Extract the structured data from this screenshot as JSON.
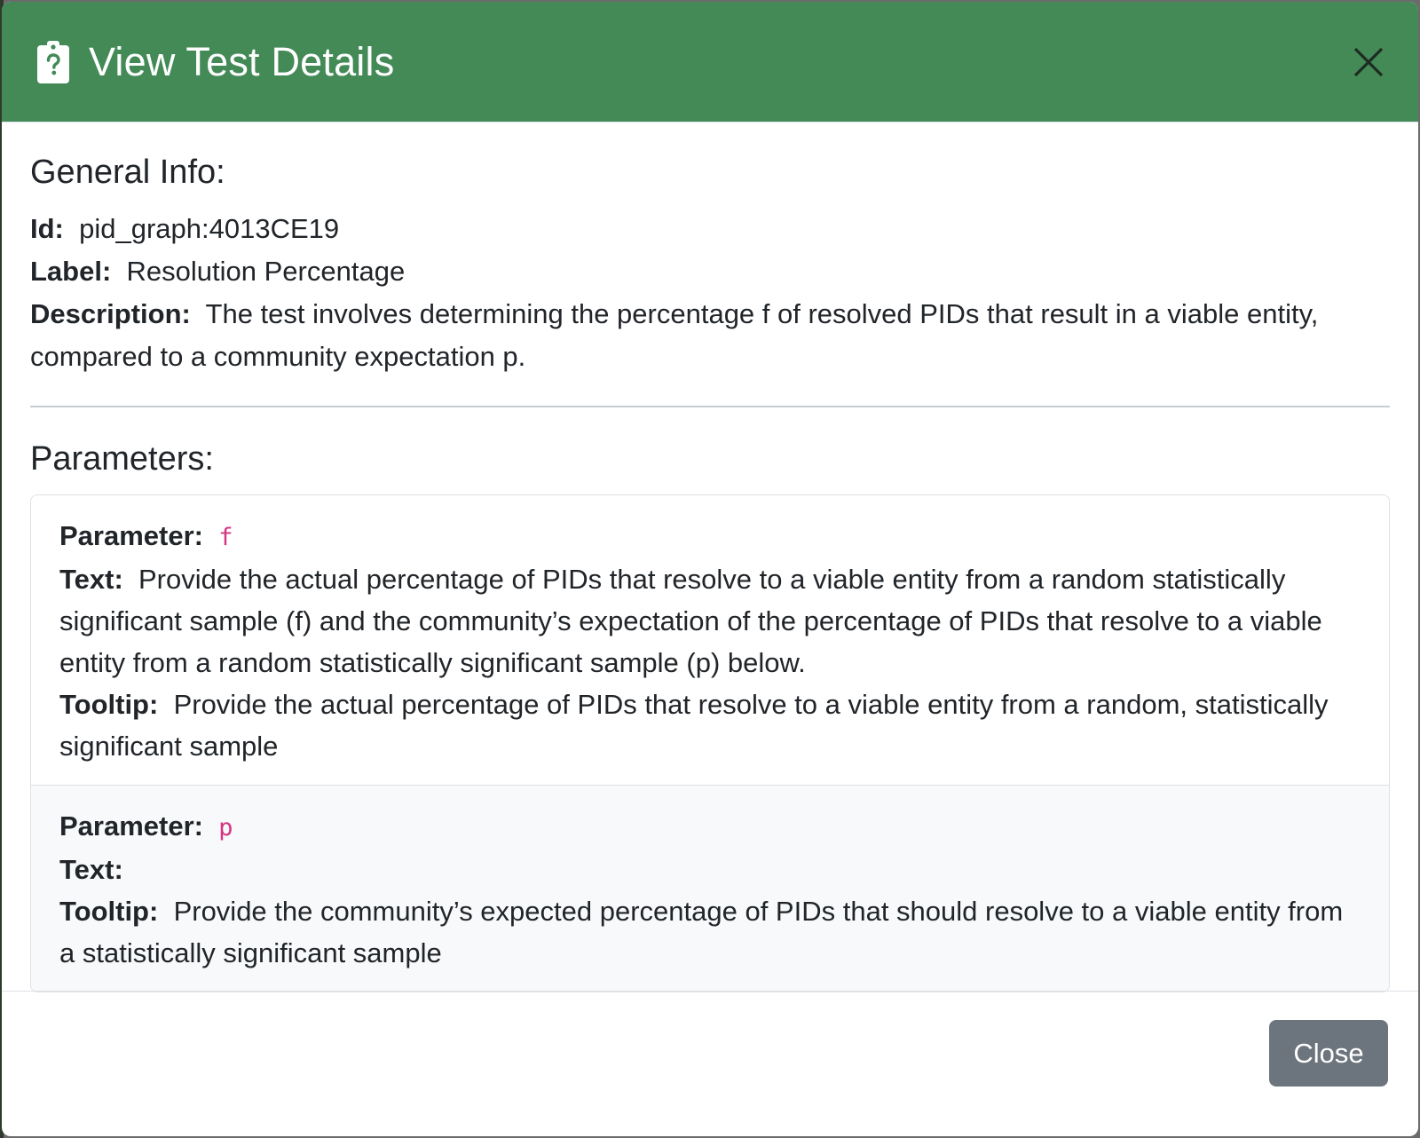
{
  "header": {
    "title": "View Test Details",
    "icon": "clipboard-question-icon",
    "close_icon": "close-icon"
  },
  "general": {
    "heading": "General Info:",
    "id_label": "Id:",
    "id_value": "pid_graph:4013CE19",
    "label_label": "Label:",
    "label_value": "Resolution Percentage",
    "description_label": "Description:",
    "description_value": "The test involves determining the percentage f of resolved PIDs that result in a viable entity, compared to a community expectation p."
  },
  "parameters": {
    "heading": "Parameters:",
    "items": [
      {
        "parameter_label": "Parameter:",
        "parameter_value": "f",
        "text_label": "Text:",
        "text_value": "Provide the actual percentage of PIDs that resolve to a viable entity from a random statistically significant sample (f) and the community’s expectation of the percentage of PIDs that resolve to a viable entity from a random statistically significant sample (p) below.",
        "tooltip_label": "Tooltip:",
        "tooltip_value": "Provide the actual percentage of PIDs that resolve to a viable entity from a random, statistically significant sample"
      },
      {
        "parameter_label": "Parameter:",
        "parameter_value": "p",
        "text_label": "Text:",
        "text_value": "",
        "tooltip_label": "Tooltip:",
        "tooltip_value": "Provide the community’s expected percentage of PIDs that should resolve to a viable entity from a statistically significant sample"
      }
    ]
  },
  "footer": {
    "close_label": "Close"
  },
  "colors": {
    "header_bg": "#438a57",
    "code_accent": "#d63384",
    "close_button_bg": "#6c757d"
  }
}
